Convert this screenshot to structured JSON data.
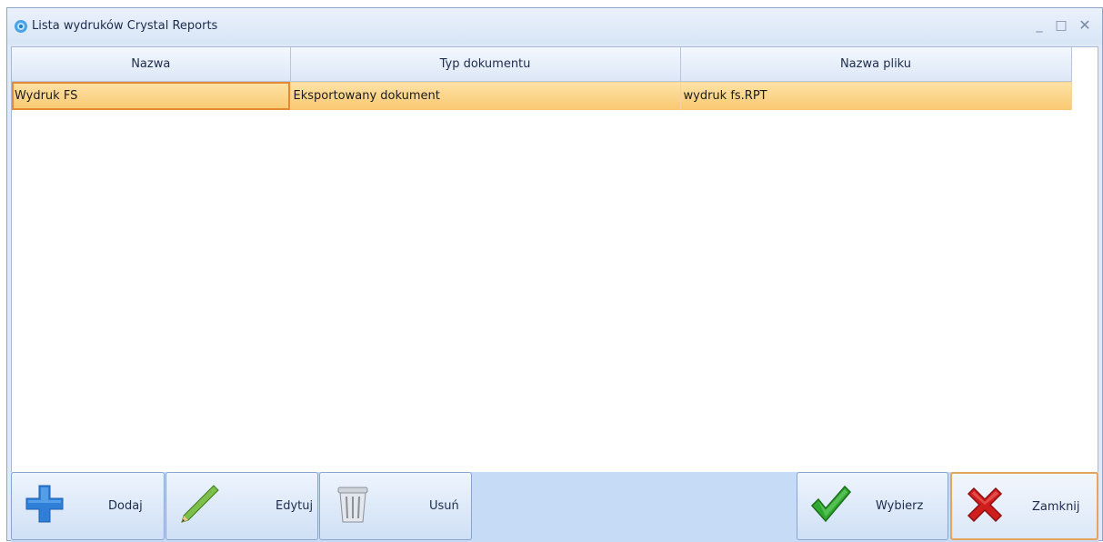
{
  "window": {
    "title": "Lista wydruków Crystal Reports",
    "controls": {
      "minimize": "_",
      "maximize": "□",
      "close": "✕"
    }
  },
  "grid": {
    "columns": [
      "Nazwa",
      "Typ dokumentu",
      "Nazwa pliku"
    ],
    "rows": [
      {
        "nazwa": "Wydruk FS",
        "typ": "Eksportowany dokument",
        "plik": "wydruk fs.RPT",
        "selected": true
      }
    ]
  },
  "toolbar": {
    "add": "Dodaj",
    "edit": "Edytuj",
    "delete": "Usuń",
    "select": "Wybierz",
    "close": "Zamknij"
  },
  "colors": {
    "selected_row": "#f9c86f",
    "focus_border": "#e58a32",
    "add_icon": "#2f7fd8",
    "check_icon": "#2fa82f",
    "close_icon": "#d01d1d"
  },
  "icons": {
    "title": "crystal-reports-icon",
    "add": "plus-icon",
    "edit": "pencil-icon",
    "delete": "trash-icon",
    "select": "check-icon",
    "close": "x-icon"
  }
}
